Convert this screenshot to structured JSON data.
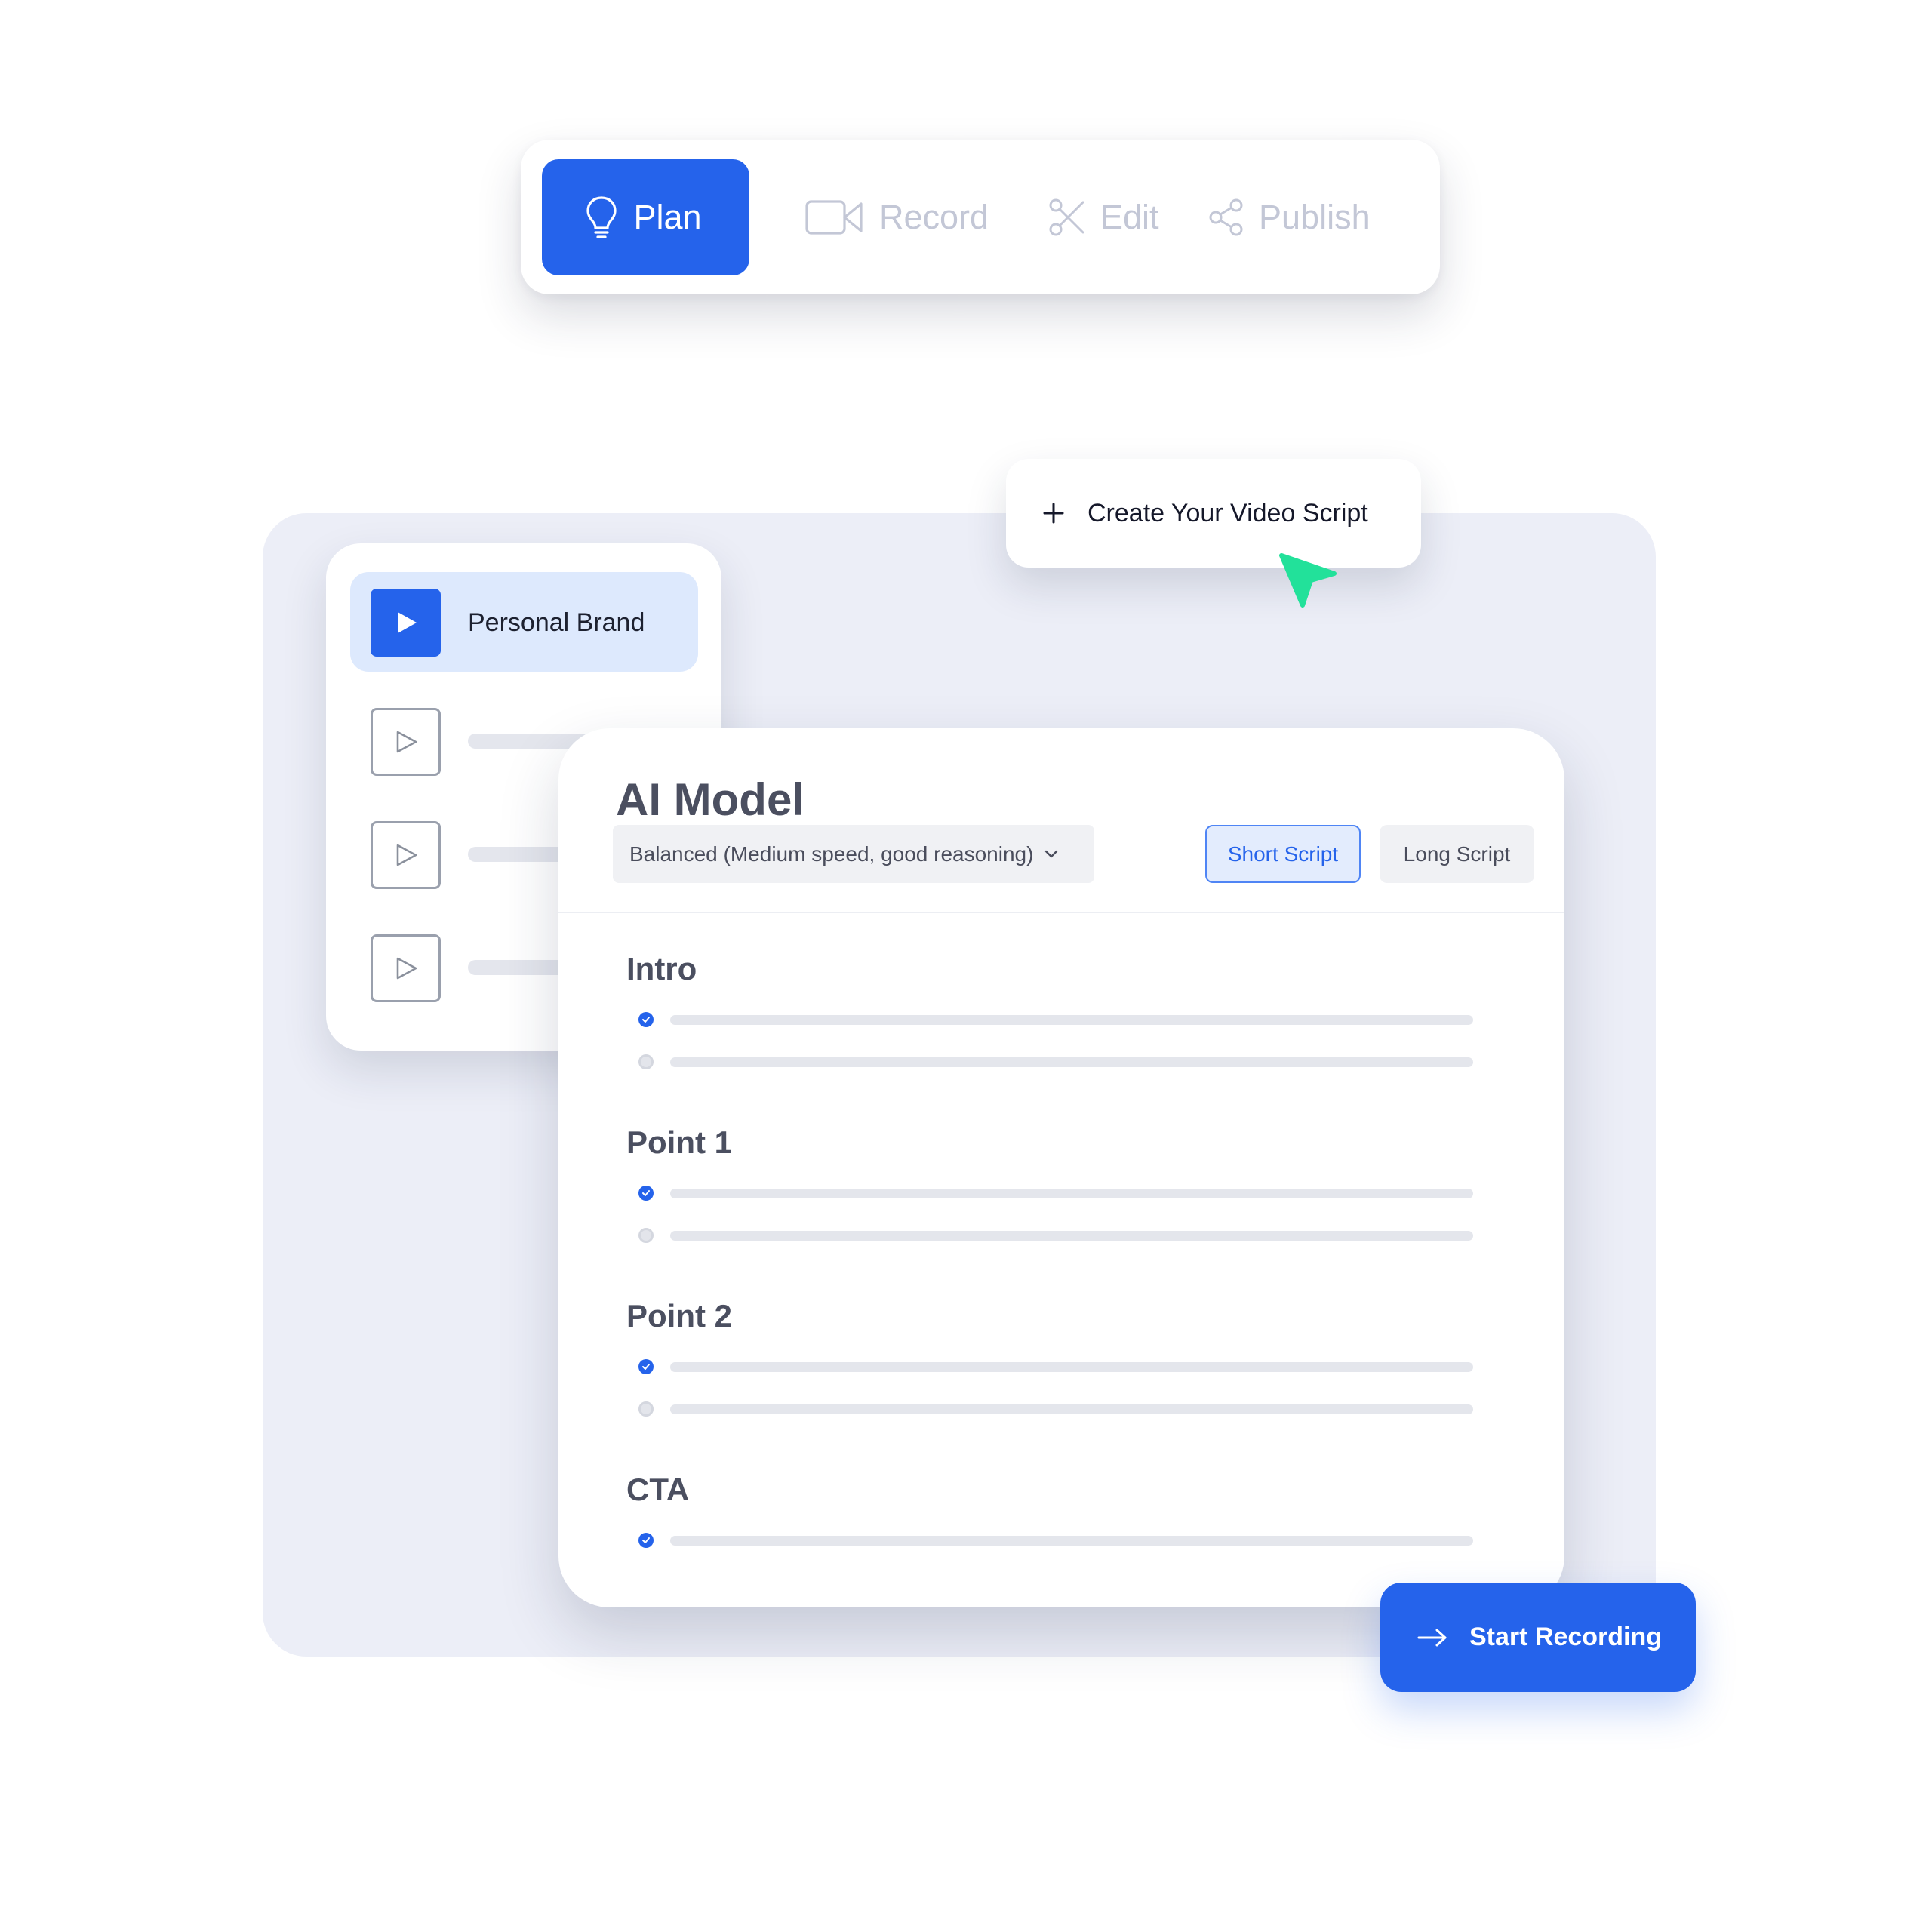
{
  "steps": {
    "plan": "Plan",
    "record": "Record",
    "edit": "Edit",
    "publish": "Publish",
    "active": "plan"
  },
  "video_list": {
    "selected_title": "Personal Brand"
  },
  "create_script": {
    "label": "Create Your Video Script"
  },
  "script_card": {
    "title": "AI Model",
    "model_select": "Balanced (Medium speed, good reasoning)",
    "short_script": "Short Script",
    "long_script": "Long Script",
    "selected_length": "Short Script",
    "sections": [
      {
        "title": "Intro"
      },
      {
        "title": "Point 1"
      },
      {
        "title": "Point 2"
      },
      {
        "title": "CTA"
      }
    ]
  },
  "start_recording": {
    "label": "Start Recording"
  },
  "colors": {
    "accent": "#2563eb",
    "cursor": "#22e19a",
    "panel": "#eceef7"
  }
}
